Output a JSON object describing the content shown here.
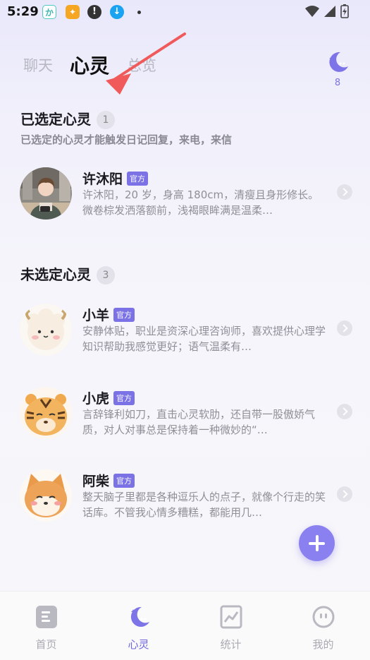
{
  "status_bar": {
    "time": "5:29"
  },
  "tabs": [
    {
      "label": "聊天",
      "active": false
    },
    {
      "label": "心灵",
      "active": true
    },
    {
      "label": "总览",
      "active": false
    }
  ],
  "moon_count": "8",
  "selected_section": {
    "title": "已选定心灵",
    "count": "1",
    "subtitle": "已选定的心灵才能触发日记回复，来电，来信"
  },
  "unselected_section": {
    "title": "未选定心灵",
    "count": "3"
  },
  "badge_label": "官方",
  "selected_minds": [
    {
      "name": "许沐阳",
      "desc": "许沐阳，20 岁，身高 180cm，清瘦且身形修长。微卷棕发洒落额前，浅褐眼眸满是温柔…",
      "avatar": "young-man-photo"
    }
  ],
  "unselected_minds": [
    {
      "name": "小羊",
      "desc": "安静体贴，职业是资深心理咨询师，喜欢提供心理学知识帮助我感觉更好；语气温柔有…",
      "avatar": "sheep-avatar"
    },
    {
      "name": "小虎",
      "desc": "言辞锋利如刀，直击心灵软肋，还自带一股傲娇气质，对人对事总是保持着一种微妙的“…",
      "avatar": "tiger-avatar"
    },
    {
      "name": "阿柴",
      "desc": "整天脑子里都是各种逗乐人的点子，就像个行走的笑话库。不管我心情多糟糕，都能用几…",
      "avatar": "shiba-avatar"
    }
  ],
  "bottom_nav": [
    {
      "label": "首页",
      "icon": "home-icon",
      "active": false
    },
    {
      "label": "心灵",
      "icon": "moon-icon",
      "active": true
    },
    {
      "label": "统计",
      "icon": "stats-icon",
      "active": false
    },
    {
      "label": "我的",
      "icon": "profile-icon",
      "active": false
    }
  ],
  "colors": {
    "accent": "#7b72e6",
    "fab": "#8a80f0",
    "arrow": "#f05a5a"
  }
}
